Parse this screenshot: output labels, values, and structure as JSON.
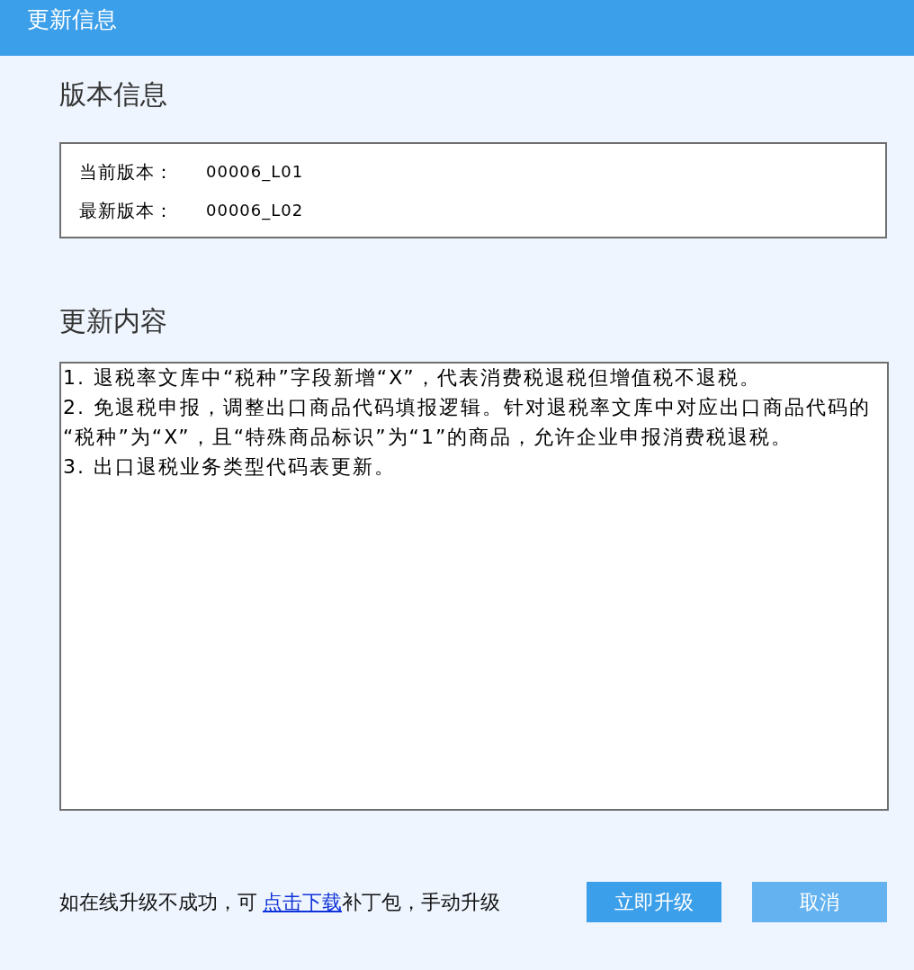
{
  "window": {
    "title": "更新信息"
  },
  "version_section": {
    "heading": "版本信息",
    "rows": [
      {
        "label": "当前版本：",
        "value": "00006_L01"
      },
      {
        "label": "最新版本：",
        "value": "00006_L02"
      }
    ]
  },
  "update_section": {
    "heading": "更新内容",
    "notes": [
      "1. 退税率文库中“税种”字段新增“X”，代表消费税退税但增值税不退税。",
      "2. 免退税申报，调整出口商品代码填报逻辑。针对退税率文库中对应出口商品代码的“税种”为“X”，且“特殊商品标识”为“1”的商品，允许企业申报消费税退税。",
      "3. 出口退税业务类型代码表更新。"
    ]
  },
  "footer": {
    "hint": {
      "before": "如在线升级不成功，可",
      "link": "点击下载",
      "after": "补丁包，手动升级"
    },
    "buttons": [
      {
        "label": "立即升级",
        "kind": "primary"
      },
      {
        "label": "取消",
        "kind": "secondary"
      }
    ]
  }
}
